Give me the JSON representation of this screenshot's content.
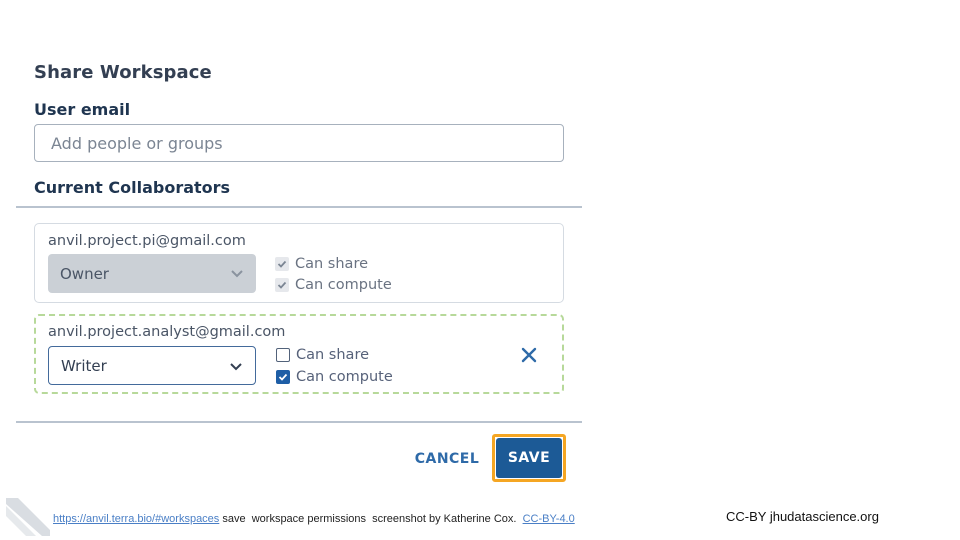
{
  "dialog": {
    "title": "Share Workspace",
    "user_email_label": "User email",
    "email_placeholder": "Add people or groups",
    "current_collaborators_label": "Current Collaborators"
  },
  "collaborators": [
    {
      "email": "anvil.project.pi@gmail.com",
      "role": "Owner",
      "can_share_label": "Can share",
      "can_compute_label": "Can compute",
      "can_share": true,
      "can_compute": true,
      "editable": false
    },
    {
      "email": "anvil.project.analyst@gmail.com",
      "role": "Writer",
      "can_share_label": "Can share",
      "can_compute_label": "Can compute",
      "can_share": false,
      "can_compute": true,
      "editable": true
    }
  ],
  "actions": {
    "cancel_label": "CANCEL",
    "save_label": "SAVE"
  },
  "footer": {
    "link_text": "https://anvil.terra.bio/#workspaces",
    "caption_text": " save  workspace permissions  screenshot by Katherine Cox.  ",
    "license_link": "CC-BY-4.0",
    "credit": "CC-BY  jhudatascience.org"
  },
  "colors": {
    "accent": "#1c5a96",
    "highlight": "#f5a623",
    "new_collaborator_border": "#b7d99a",
    "link": "#4a7fc6"
  },
  "icons": {
    "select_caret": "chevron-down-icon",
    "remove": "close-icon",
    "checkbox": "checkmark-icon"
  }
}
